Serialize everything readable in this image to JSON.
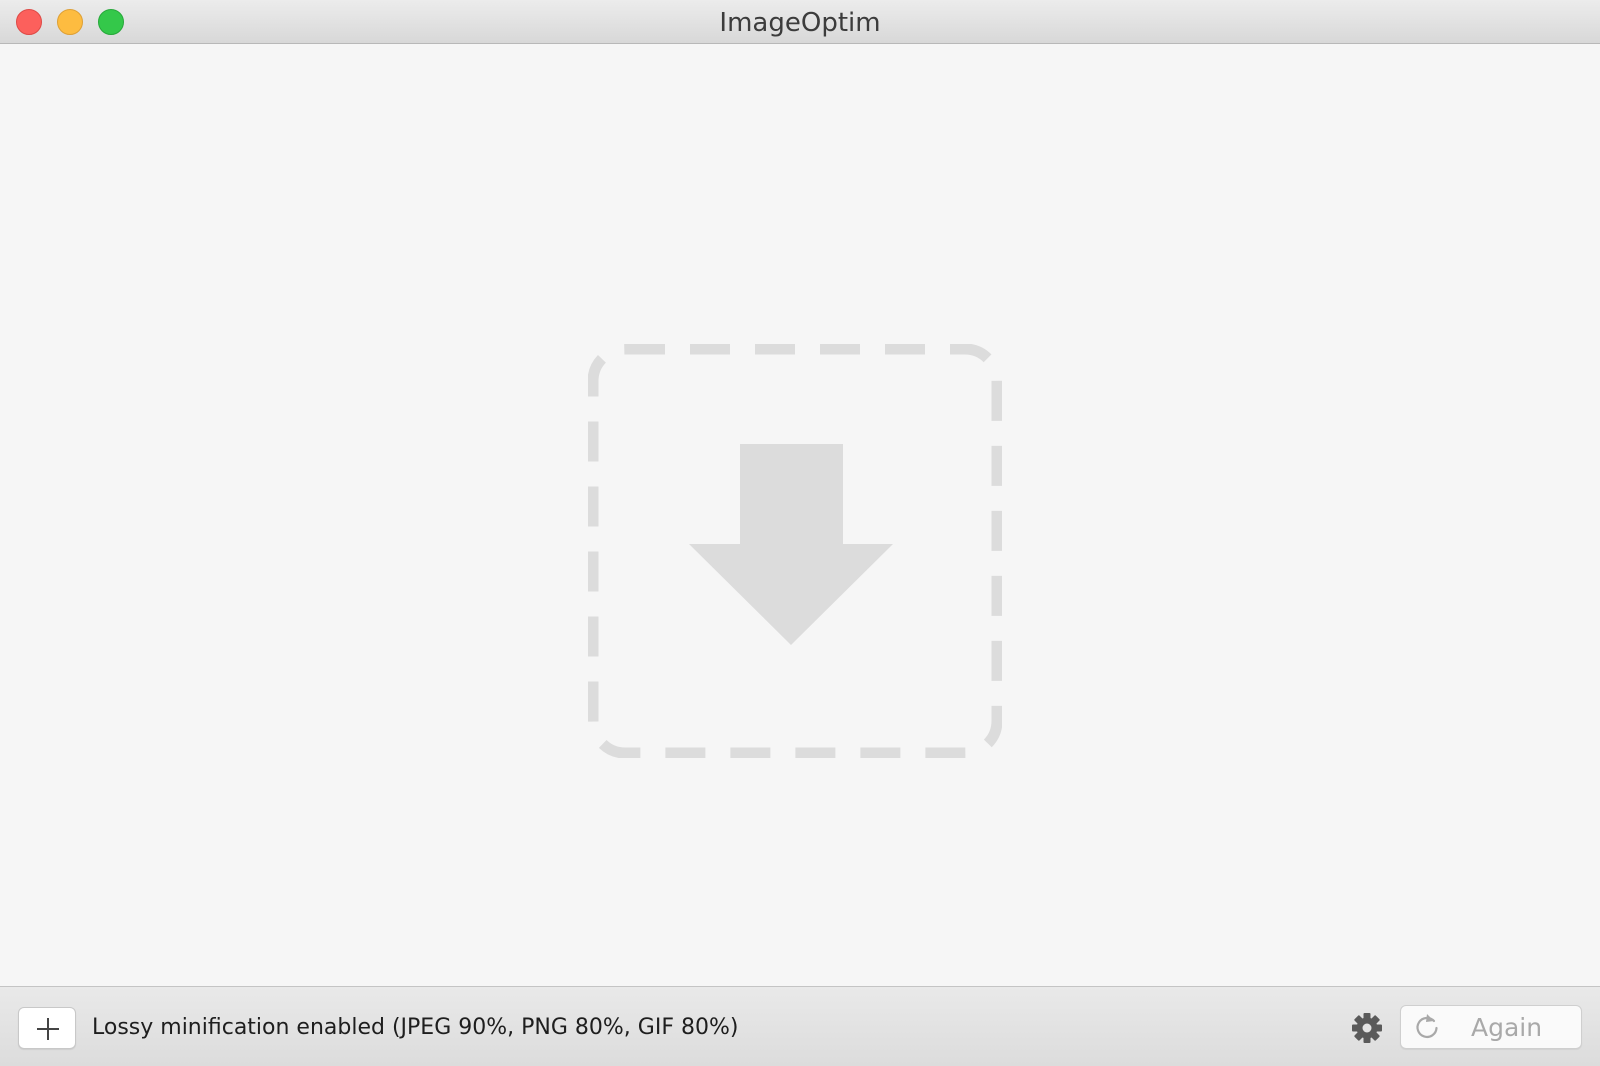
{
  "window": {
    "title": "ImageOptim",
    "controls": [
      "close",
      "minimize",
      "zoom"
    ]
  },
  "dropzone": {
    "icon": "download-arrow-icon",
    "color": "#dcdcdc"
  },
  "toolbar": {
    "add_icon": "plus-icon",
    "status_text": "Lossy minification enabled (JPEG 90%, PNG 80%, GIF 80%)",
    "settings_icon": "gear-icon",
    "again_icon": "refresh-icon",
    "again_label": "Again",
    "again_enabled": false
  }
}
